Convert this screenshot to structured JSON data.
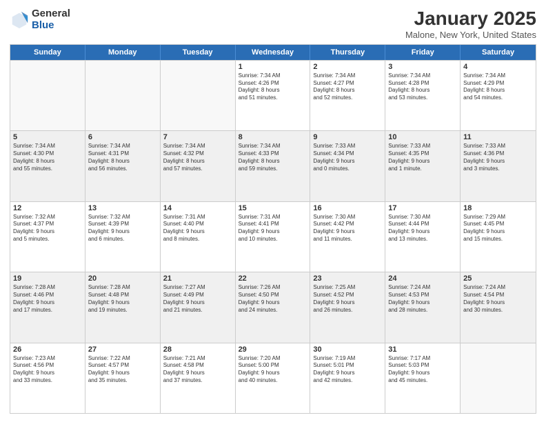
{
  "header": {
    "logo_general": "General",
    "logo_blue": "Blue",
    "title": "January 2025",
    "location": "Malone, New York, United States"
  },
  "weekdays": [
    "Sunday",
    "Monday",
    "Tuesday",
    "Wednesday",
    "Thursday",
    "Friday",
    "Saturday"
  ],
  "rows": [
    [
      {
        "day": "",
        "info": "",
        "empty": true
      },
      {
        "day": "",
        "info": "",
        "empty": true
      },
      {
        "day": "",
        "info": "",
        "empty": true
      },
      {
        "day": "1",
        "info": "Sunrise: 7:34 AM\nSunset: 4:26 PM\nDaylight: 8 hours\nand 51 minutes."
      },
      {
        "day": "2",
        "info": "Sunrise: 7:34 AM\nSunset: 4:27 PM\nDaylight: 8 hours\nand 52 minutes."
      },
      {
        "day": "3",
        "info": "Sunrise: 7:34 AM\nSunset: 4:28 PM\nDaylight: 8 hours\nand 53 minutes."
      },
      {
        "day": "4",
        "info": "Sunrise: 7:34 AM\nSunset: 4:29 PM\nDaylight: 8 hours\nand 54 minutes."
      }
    ],
    [
      {
        "day": "5",
        "info": "Sunrise: 7:34 AM\nSunset: 4:30 PM\nDaylight: 8 hours\nand 55 minutes."
      },
      {
        "day": "6",
        "info": "Sunrise: 7:34 AM\nSunset: 4:31 PM\nDaylight: 8 hours\nand 56 minutes."
      },
      {
        "day": "7",
        "info": "Sunrise: 7:34 AM\nSunset: 4:32 PM\nDaylight: 8 hours\nand 57 minutes."
      },
      {
        "day": "8",
        "info": "Sunrise: 7:34 AM\nSunset: 4:33 PM\nDaylight: 8 hours\nand 59 minutes."
      },
      {
        "day": "9",
        "info": "Sunrise: 7:33 AM\nSunset: 4:34 PM\nDaylight: 9 hours\nand 0 minutes."
      },
      {
        "day": "10",
        "info": "Sunrise: 7:33 AM\nSunset: 4:35 PM\nDaylight: 9 hours\nand 1 minute."
      },
      {
        "day": "11",
        "info": "Sunrise: 7:33 AM\nSunset: 4:36 PM\nDaylight: 9 hours\nand 3 minutes."
      }
    ],
    [
      {
        "day": "12",
        "info": "Sunrise: 7:32 AM\nSunset: 4:37 PM\nDaylight: 9 hours\nand 5 minutes."
      },
      {
        "day": "13",
        "info": "Sunrise: 7:32 AM\nSunset: 4:39 PM\nDaylight: 9 hours\nand 6 minutes."
      },
      {
        "day": "14",
        "info": "Sunrise: 7:31 AM\nSunset: 4:40 PM\nDaylight: 9 hours\nand 8 minutes."
      },
      {
        "day": "15",
        "info": "Sunrise: 7:31 AM\nSunset: 4:41 PM\nDaylight: 9 hours\nand 10 minutes."
      },
      {
        "day": "16",
        "info": "Sunrise: 7:30 AM\nSunset: 4:42 PM\nDaylight: 9 hours\nand 11 minutes."
      },
      {
        "day": "17",
        "info": "Sunrise: 7:30 AM\nSunset: 4:44 PM\nDaylight: 9 hours\nand 13 minutes."
      },
      {
        "day": "18",
        "info": "Sunrise: 7:29 AM\nSunset: 4:45 PM\nDaylight: 9 hours\nand 15 minutes."
      }
    ],
    [
      {
        "day": "19",
        "info": "Sunrise: 7:28 AM\nSunset: 4:46 PM\nDaylight: 9 hours\nand 17 minutes."
      },
      {
        "day": "20",
        "info": "Sunrise: 7:28 AM\nSunset: 4:48 PM\nDaylight: 9 hours\nand 19 minutes."
      },
      {
        "day": "21",
        "info": "Sunrise: 7:27 AM\nSunset: 4:49 PM\nDaylight: 9 hours\nand 21 minutes."
      },
      {
        "day": "22",
        "info": "Sunrise: 7:26 AM\nSunset: 4:50 PM\nDaylight: 9 hours\nand 24 minutes."
      },
      {
        "day": "23",
        "info": "Sunrise: 7:25 AM\nSunset: 4:52 PM\nDaylight: 9 hours\nand 26 minutes."
      },
      {
        "day": "24",
        "info": "Sunrise: 7:24 AM\nSunset: 4:53 PM\nDaylight: 9 hours\nand 28 minutes."
      },
      {
        "day": "25",
        "info": "Sunrise: 7:24 AM\nSunset: 4:54 PM\nDaylight: 9 hours\nand 30 minutes."
      }
    ],
    [
      {
        "day": "26",
        "info": "Sunrise: 7:23 AM\nSunset: 4:56 PM\nDaylight: 9 hours\nand 33 minutes."
      },
      {
        "day": "27",
        "info": "Sunrise: 7:22 AM\nSunset: 4:57 PM\nDaylight: 9 hours\nand 35 minutes."
      },
      {
        "day": "28",
        "info": "Sunrise: 7:21 AM\nSunset: 4:58 PM\nDaylight: 9 hours\nand 37 minutes."
      },
      {
        "day": "29",
        "info": "Sunrise: 7:20 AM\nSunset: 5:00 PM\nDaylight: 9 hours\nand 40 minutes."
      },
      {
        "day": "30",
        "info": "Sunrise: 7:19 AM\nSunset: 5:01 PM\nDaylight: 9 hours\nand 42 minutes."
      },
      {
        "day": "31",
        "info": "Sunrise: 7:17 AM\nSunset: 5:03 PM\nDaylight: 9 hours\nand 45 minutes."
      },
      {
        "day": "",
        "info": "",
        "empty": true
      }
    ]
  ]
}
